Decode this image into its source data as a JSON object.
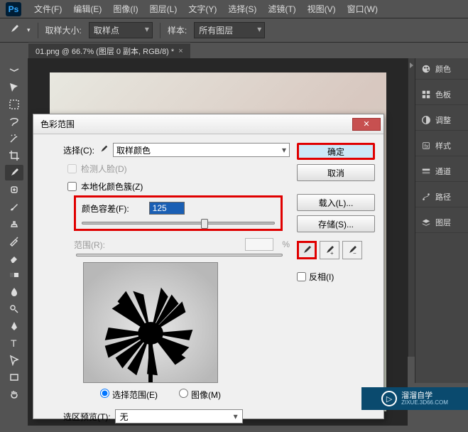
{
  "window": {
    "minimize": "—",
    "maximize": "□",
    "close": "✕"
  },
  "menubar": {
    "file": "文件(F)",
    "edit": "编辑(E)",
    "image": "图像(I)",
    "layer": "图层(L)",
    "type": "文字(Y)",
    "select": "选择(S)",
    "filter": "滤镜(T)",
    "view": "视图(V)",
    "window": "窗口(W)"
  },
  "optionsbar": {
    "sample_size_label": "取样大小:",
    "sample_size_value": "取样点",
    "sample_label": "样本:",
    "sample_value": "所有图层"
  },
  "tab": {
    "title": "01.png @ 66.7% (图层 0 副本, RGB/8) *",
    "close": "×"
  },
  "panels": {
    "color": "颜色",
    "swatches": "色板",
    "adjustments": "调整",
    "styles": "样式",
    "channels": "通道",
    "paths": "路径",
    "layers": "图层"
  },
  "dialog": {
    "title": "色彩范围",
    "select_label": "选择(C):",
    "select_value": "取样颜色",
    "detect_faces": "检测人脸(D)",
    "localized": "本地化颜色簇(Z)",
    "fuzziness_label": "颜色容差(F):",
    "fuzziness_value": "125",
    "range_label": "范围(R):",
    "range_unit": "%",
    "radio_selection": "选择范围(E)",
    "radio_image": "图像(M)",
    "preview_label": "选区预览(T):",
    "preview_value": "无",
    "ok": "确定",
    "cancel": "取消",
    "load": "载入(L)...",
    "save": "存储(S)...",
    "invert": "反相(I)"
  },
  "watermark": {
    "brand": "溜溜自学",
    "url": "ZIXUE.3D66.COM",
    "play": "▷"
  }
}
